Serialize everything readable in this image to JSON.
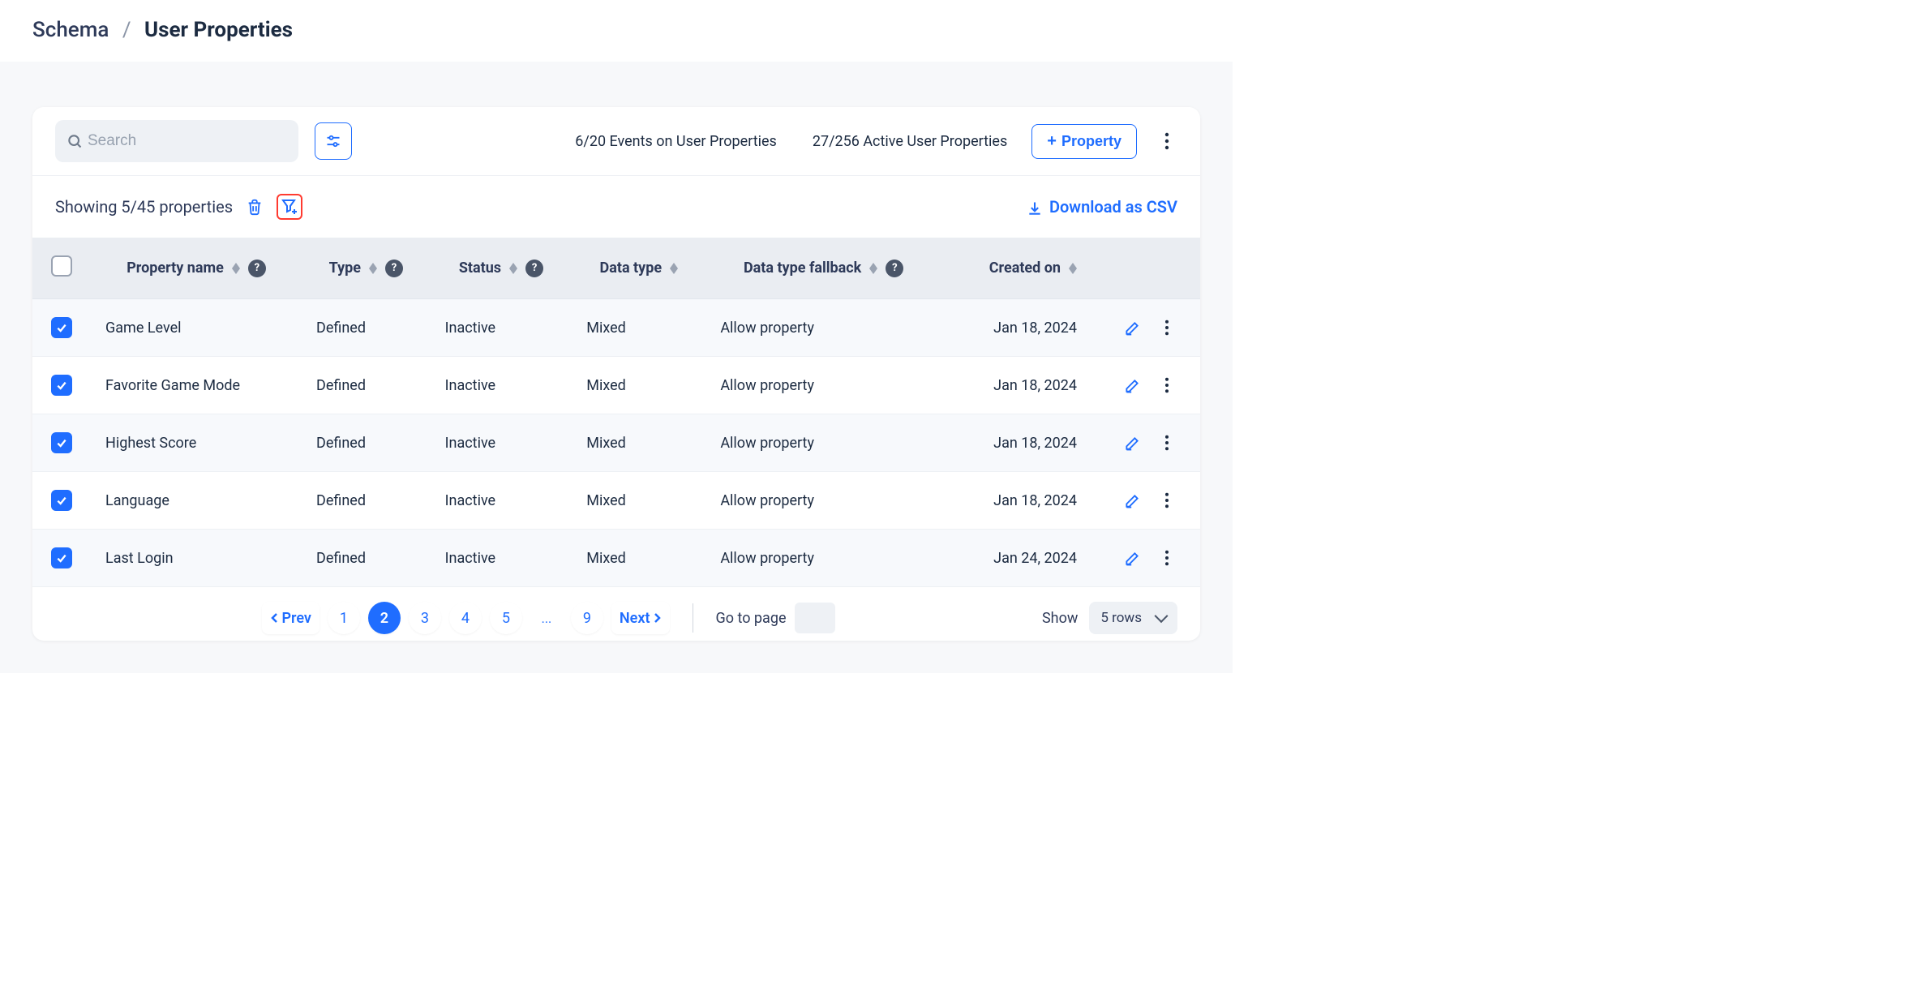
{
  "breadcrumb": {
    "root": "Schema",
    "current": "User Properties"
  },
  "topbar": {
    "search_placeholder": "Search",
    "stat_events": "6/20 Events on User Properties",
    "stat_active": "27/256 Active User Properties",
    "add_property_label": "Property"
  },
  "subbar": {
    "showing": "Showing 5/45 properties",
    "download_label": "Download as CSV"
  },
  "columns": {
    "property_name": "Property name",
    "type": "Type",
    "status": "Status",
    "data_type": "Data type",
    "fallback": "Data type fallback",
    "created": "Created on"
  },
  "rows": [
    {
      "checked": true,
      "name": "Game Level",
      "type": "Defined",
      "status": "Inactive",
      "data_type": "Mixed",
      "fallback": "Allow property",
      "created": "Jan 18, 2024"
    },
    {
      "checked": true,
      "name": "Favorite Game Mode",
      "type": "Defined",
      "status": "Inactive",
      "data_type": "Mixed",
      "fallback": "Allow property",
      "created": "Jan 18, 2024"
    },
    {
      "checked": true,
      "name": "Highest Score",
      "type": "Defined",
      "status": "Inactive",
      "data_type": "Mixed",
      "fallback": "Allow property",
      "created": "Jan 18, 2024"
    },
    {
      "checked": true,
      "name": "Language",
      "type": "Defined",
      "status": "Inactive",
      "data_type": "Mixed",
      "fallback": "Allow property",
      "created": "Jan 18, 2024"
    },
    {
      "checked": true,
      "name": "Last Login",
      "type": "Defined",
      "status": "Inactive",
      "data_type": "Mixed",
      "fallback": "Allow property",
      "created": "Jan 24, 2024"
    }
  ],
  "pagination": {
    "prev": "Prev",
    "next": "Next",
    "pages": [
      "1",
      "2",
      "3",
      "4",
      "5",
      "...",
      "9"
    ],
    "active_index": 1,
    "goto_label": "Go to page",
    "show_label": "Show",
    "show_value": "5 rows"
  }
}
